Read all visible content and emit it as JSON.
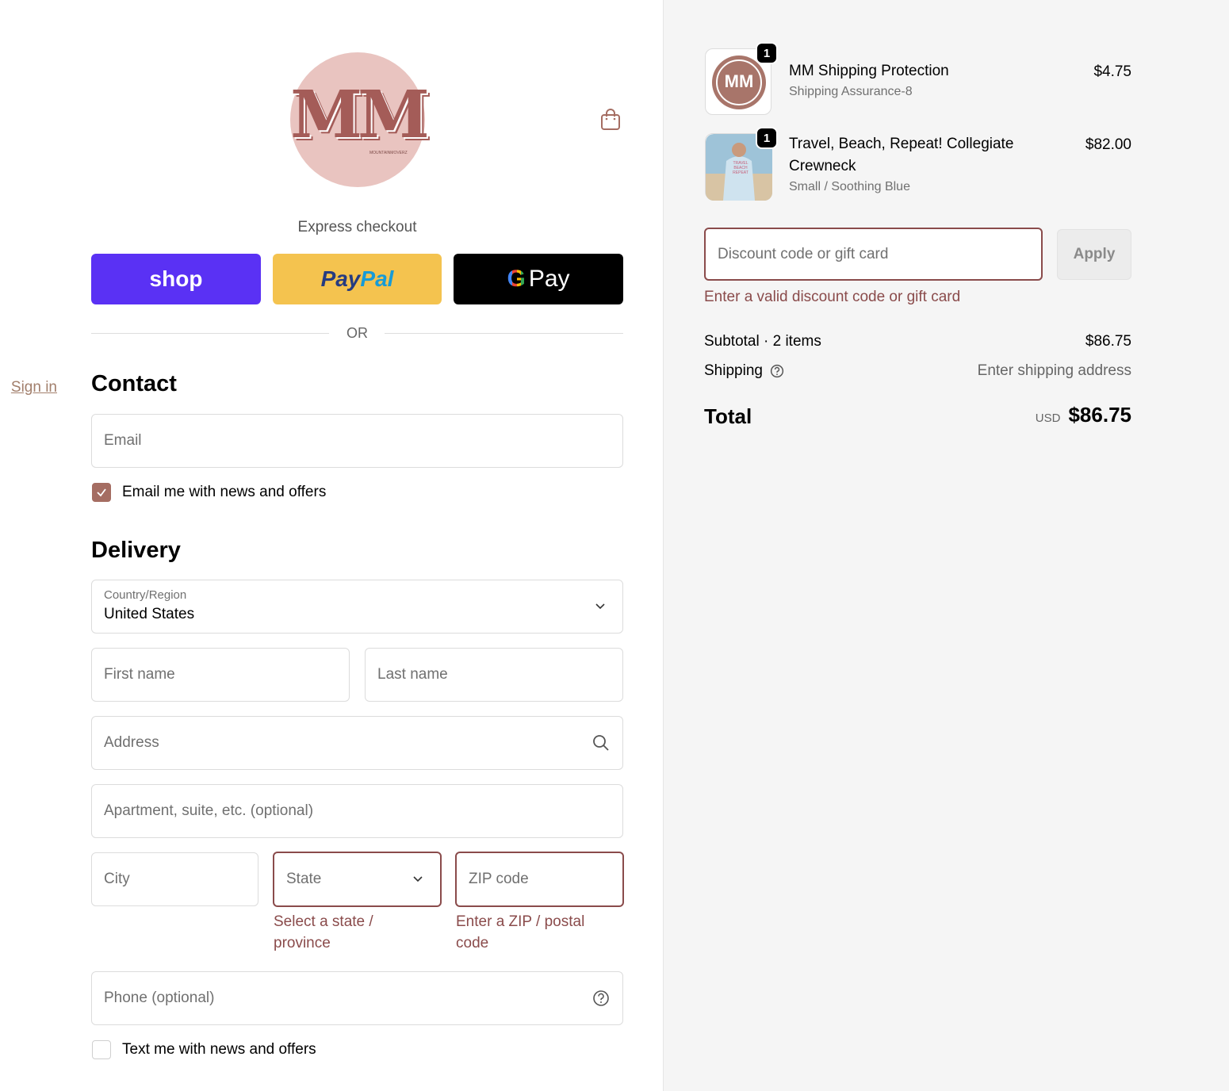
{
  "store": {
    "logo_text": "MM",
    "logo_subtext": "MOUNTAINMOVERZ"
  },
  "express": {
    "label": "Express checkout",
    "shop_label": "shop",
    "paypal_part1": "Pay",
    "paypal_part2": "Pal",
    "gpay_g": "G",
    "gpay_label": "Pay",
    "or_label": "OR"
  },
  "contact": {
    "title": "Contact",
    "signin_label": "Sign in",
    "email_placeholder": "Email",
    "news_label": "Email me with news and offers",
    "news_checked": true
  },
  "delivery": {
    "title": "Delivery",
    "country_label": "Country/Region",
    "country_value": "United States",
    "first_name_placeholder": "First name",
    "last_name_placeholder": "Last name",
    "address_placeholder": "Address",
    "apartment_placeholder": "Apartment, suite, etc. (optional)",
    "city_placeholder": "City",
    "state_placeholder": "State",
    "state_error": "Select a state / province",
    "zip_placeholder": "ZIP code",
    "zip_error": "Enter a ZIP / postal code",
    "phone_placeholder": "Phone (optional)",
    "sms_label": "Text me with news and offers",
    "sms_checked": false
  },
  "cart": {
    "items": [
      {
        "quantity": "1",
        "name": "MM Shipping Protection",
        "variant": "Shipping Assurance-8",
        "price": "$4.75",
        "thumb_text": "MM"
      },
      {
        "quantity": "1",
        "name": "Travel, Beach, Repeat! Collegiate Crewneck",
        "variant": "Small / Soothing Blue",
        "price": "$82.00",
        "thumb_text": "TRAVEL BEACH REPEAT"
      }
    ],
    "discount_placeholder": "Discount code or gift card",
    "apply_label": "Apply",
    "discount_error": "Enter a valid discount code or gift card",
    "subtotal_label": "Subtotal · 2 items",
    "subtotal_value": "$86.75",
    "shipping_label": "Shipping",
    "shipping_value": "Enter shipping address",
    "total_label": "Total",
    "currency": "USD",
    "total_value": "$86.75"
  },
  "colors": {
    "accent": "#a56d62",
    "error": "#8a4b4b",
    "shop_purple": "#5a31f4",
    "paypal_yellow": "#f4c34f",
    "sidebar_bg": "#f5f5f5"
  }
}
